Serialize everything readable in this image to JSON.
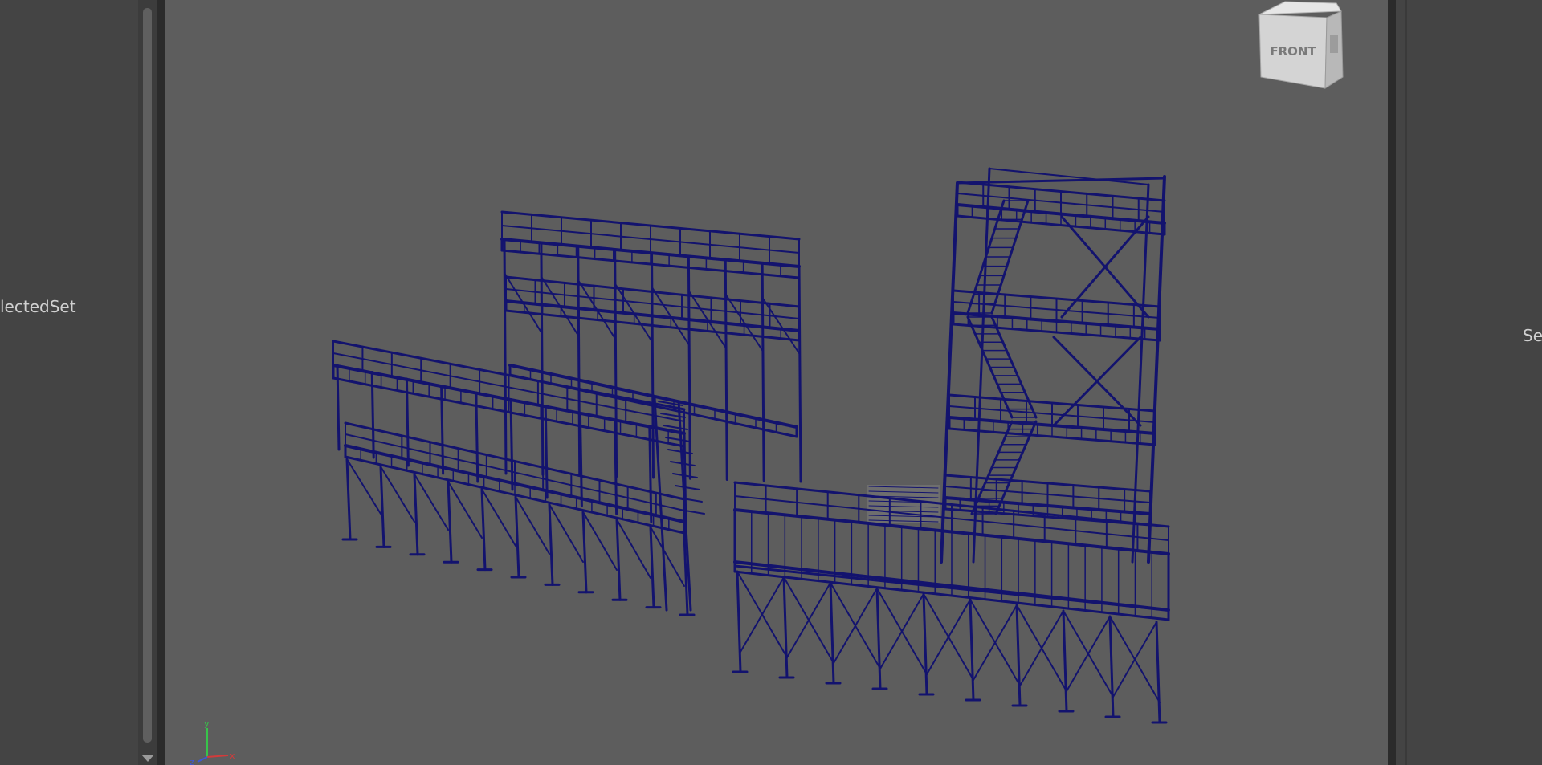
{
  "outliner": {
    "set_label": "lectedSet"
  },
  "attribute_panel": {
    "set_label": "Se"
  },
  "viewport": {
    "view_cube_face": "FRONT",
    "axis_labels": {
      "x": "x",
      "y": "y",
      "z": "z"
    },
    "wireframe_color": "#13136e",
    "background_color": "#5d5d5d"
  },
  "icons": {
    "view_cube": "view-cube-icon",
    "axis_gizmo": "axis-gizmo-icon",
    "scroll_down": "scroll-down-arrow-icon"
  }
}
